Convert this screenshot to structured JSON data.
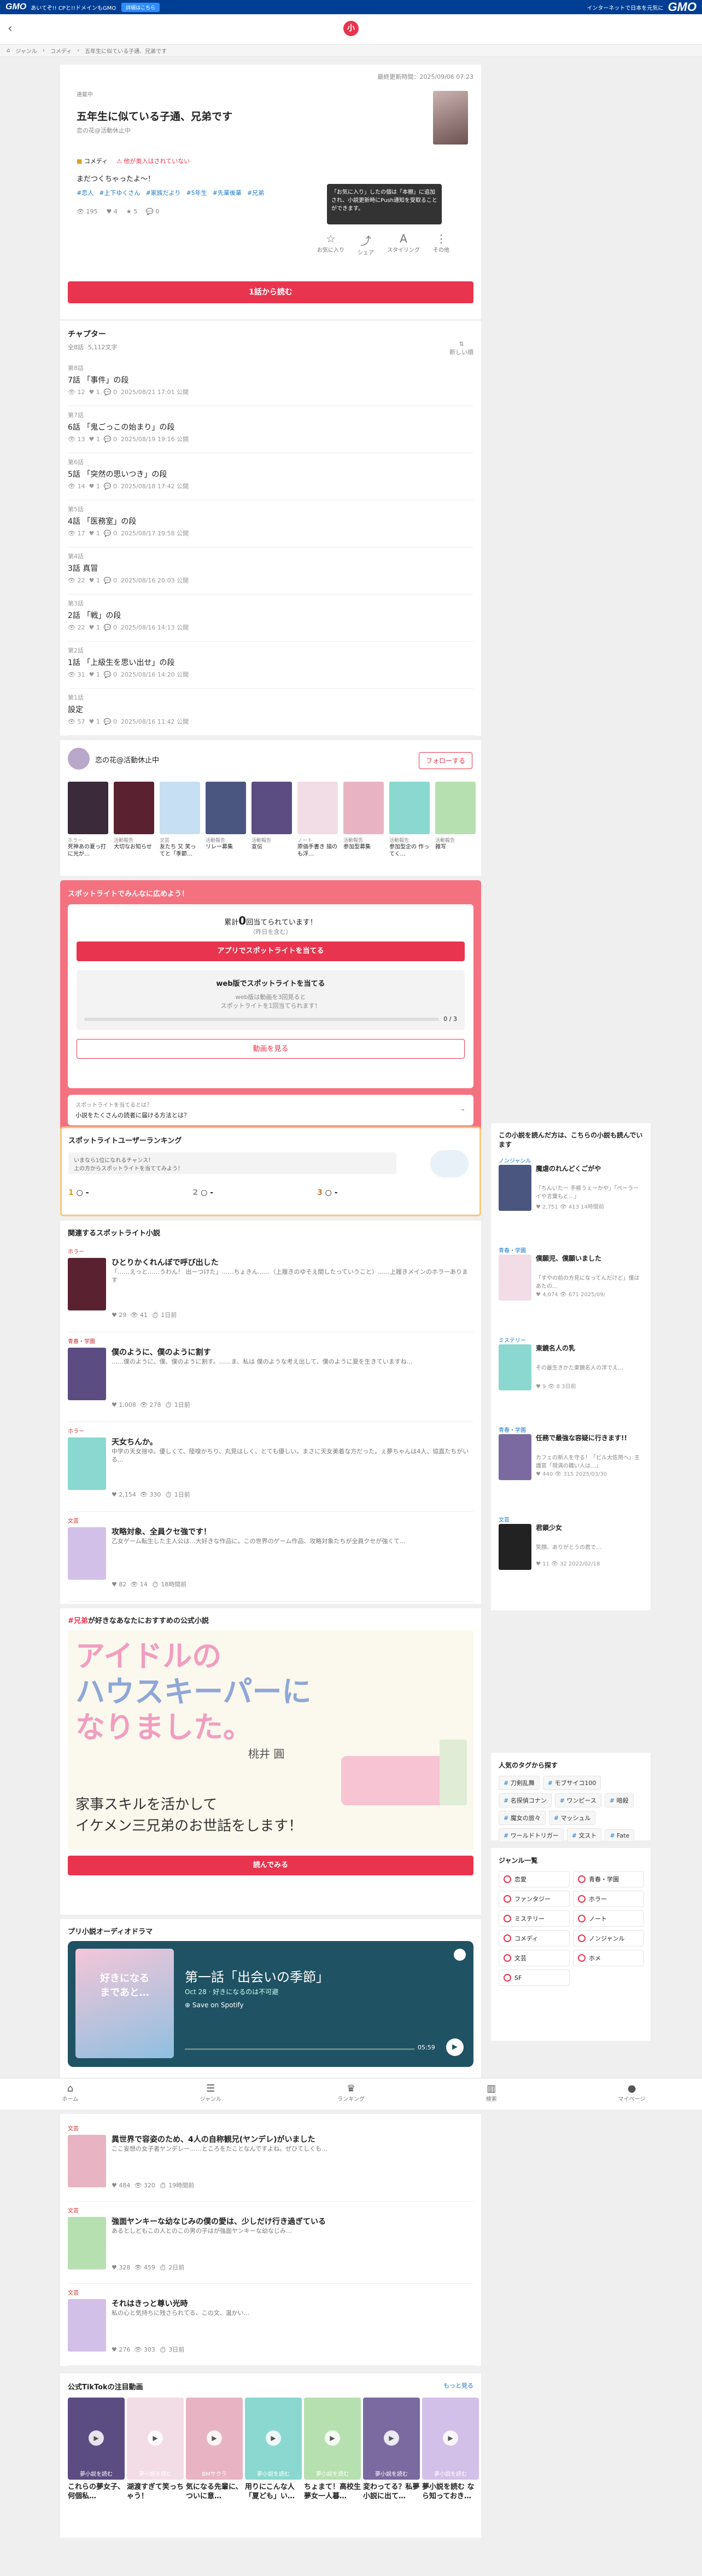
{
  "gmo": {
    "logo": "GMO",
    "tagline": "あいてぞ!! CPと!!ドメインもGMO",
    "pill": "詳細はこちら",
    "right_text": "インターネットで日本を元気に",
    "right_logo": "GMO"
  },
  "header": {
    "logo_char": "小"
  },
  "breadcrumb": [
    "ジャンル",
    "コメディ",
    "五年生に似ている子通、兄弟です"
  ],
  "novel": {
    "updated": "最終更新時間：2025/09/06 07:23",
    "status": "連載中",
    "title": "五年生に似ている子通、兄弟です",
    "author": "恋の花@活動休止中",
    "genre": "コメディ",
    "badge": "他が奥入はされていない",
    "desc": "まだつくちゃったよ〜！",
    "tags": [
      "#恋人",
      "#上下ゆくさん",
      "#家族だより",
      "#5年生",
      "#先輩後輩",
      "#兄弟"
    ],
    "stats": {
      "views": "195",
      "likes": "4",
      "stars": "5",
      "comments": "0"
    },
    "tooltip": "「お気に入り」したの個は「本棚」に追加され、小説更新時にPush通知を受取ることができます。",
    "actions": [
      "お気に入り",
      "シェア",
      "スタイリング",
      "その他"
    ],
    "read_btn": "1話から読む"
  },
  "chapters": {
    "title": "チャプター",
    "count": "全8話",
    "chars": "5,112文字",
    "sort": "新しい順",
    "items": [
      {
        "ep": "第8話",
        "title": "7話 「事件」の段",
        "views": "12",
        "likes": "1",
        "com": "0",
        "date": "2025/08/21 17:01 公開"
      },
      {
        "ep": "第7話",
        "title": "6話 「鬼ごっこの始まり」の段",
        "views": "13",
        "likes": "1",
        "com": "0",
        "date": "2025/08/19 19:16 公開"
      },
      {
        "ep": "第6話",
        "title": "5話 「突然の思いつき」の段",
        "views": "14",
        "likes": "1",
        "com": "0",
        "date": "2025/08/18 17:42 公開"
      },
      {
        "ep": "第5話",
        "title": "4話 「医務室」の段",
        "views": "17",
        "likes": "1",
        "com": "0",
        "date": "2025/08/17 19:58 公開"
      },
      {
        "ep": "第4話",
        "title": "3話 真冒",
        "views": "22",
        "likes": "1",
        "com": "0",
        "date": "2025/08/16 20:03 公開"
      },
      {
        "ep": "第3話",
        "title": "2話 「戦」の段",
        "views": "22",
        "likes": "1",
        "com": "0",
        "date": "2025/08/16 14:13 公開"
      },
      {
        "ep": "第2話",
        "title": "1話 「上級生を思い出せ」の段",
        "views": "31",
        "likes": "1",
        "com": "0",
        "date": "2025/08/16 14:20 公開"
      },
      {
        "ep": "第1話",
        "title": "設定",
        "views": "57",
        "likes": "1",
        "com": "0",
        "date": "2025/08/16 11:42 公開"
      }
    ]
  },
  "author_box": {
    "name": "恋の花@活動休止中",
    "follow": "フォローする",
    "works": [
      {
        "cat": "ホラー",
        "name": "死神あの夏っ打に光が…"
      },
      {
        "cat": "活動報告",
        "name": "大切なお知らせ"
      },
      {
        "cat": "文芸",
        "name": "友たち 又 笑ってと「季節…"
      },
      {
        "cat": "活動報告",
        "name": "リレー募集"
      },
      {
        "cat": "活動報告",
        "name": "宣伝"
      },
      {
        "cat": "ノート",
        "name": "原価手書き 描のも浮…"
      },
      {
        "cat": "活動報告",
        "name": "参加型募集"
      },
      {
        "cat": "活動報告",
        "name": "参加型企の 作ってく…"
      },
      {
        "cat": "活動報告",
        "name": "雑写"
      }
    ]
  },
  "spotlight": {
    "header": "スポットライトでみんなに広めよう！",
    "received_pre": "累計",
    "received_num": "0",
    "received_post": "回当てられています！",
    "received_sub": "（昨日を含む）",
    "btn": "アプリでスポットライトを当てる",
    "web_title": "web版でスポットライトを当てる",
    "web_desc": "web版は動画を3回見ると\nスポットライトを1回当てられます！",
    "progress_label": "0 / 3",
    "watch_btn": "動画を見る",
    "faq_q": "スポットライトを当てるとは？",
    "faq_a": "小説をたくさんの読者に届ける方法とは？"
  },
  "spot_ranking": {
    "title": "スポットライトユーザーランキング",
    "desc": "いまなら1位になれるチャンス！\n上の方からスポットライトを当ててみよう！",
    "ranks": [
      "1",
      "2",
      "3"
    ]
  },
  "related": {
    "title": "関連するスポットライト小説",
    "items": [
      {
        "genre": "ホラー",
        "title": "ひとりかくれんぼで呼び出した",
        "desc": "「……えっと……うわん！ 出ーつけた」……ちょきん……（上履きのゆそえ間したっていうこと）……上履きメインのホラーあります",
        "likes": "29",
        "views": "41",
        "date": "1日前"
      },
      {
        "genre": "青春・学園",
        "title": "僕のように、僕のように割す",
        "desc": "……僕のように、僕、僕のように割す。……ま、私は 僕のような考え出して、僕のように夏を生きていますね…",
        "likes": "1,008",
        "views": "278",
        "date": "1日前"
      },
      {
        "genre": "ホラー",
        "title": "天女ちんか。",
        "desc": "中学の天女捨ゆ。優しくて、陸嗅かちり、丸見はしく、とても優しい。まさに天女美着な方だった。ぇ夢ちゃんは4人、協直たちがいる…",
        "likes": "2,154",
        "views": "330",
        "date": "1日前"
      },
      {
        "genre": "文芸",
        "title": "攻略対象、全員クセ強です！",
        "desc": "乙女ゲーム転生した主人公は…大好きな作品に。この世界のゲーム作品、攻略対象たちが全員クセが強くて…",
        "likes": "82",
        "views": "14",
        "date": "18時間前"
      }
    ]
  },
  "official": {
    "tag": "#兄弟",
    "title_rest": "が好きなあなたにおすすめの公式小説",
    "banner_l1": "アイドルの",
    "banner_l2": "ハウスキーパーに",
    "banner_l3": "なりました。",
    "banner_author": "桃井 圓",
    "banner_sub1": "家事スキルを活かして",
    "banner_sub2": "イケメン三兄弟のお世話をします！",
    "btn": "読んでみる"
  },
  "audio": {
    "title": "プリ小説オーディオドラマ",
    "ep": "第一話「出会いの季節」",
    "meta": "Oct 28 · 好きになるのは不可避",
    "save": "Save on Spotify",
    "time": "05:59",
    "cover": "好きになる\nまであと…"
  },
  "sidebar": {
    "title": "この小説を読んだ方は、こちらの小説も読んでいます",
    "items": [
      {
        "genre": "ノンジャンル",
        "title": "魔虐のれんどくごがや",
        "desc": "「ちんいたー 手帳うぇーかや」「ペーラーイや言葉もと…」",
        "likes": "2,751",
        "views": "413",
        "date": "14時間前"
      },
      {
        "genre": "青春・学園",
        "title": "僕願児、僕願いました",
        "desc": "「すやの前の方見になってんだけど」僕はあたの…",
        "likes": "4,074",
        "views": "671",
        "date": "2025/09/"
      },
      {
        "genre": "ミステリー",
        "title": "東鏡名人の乳",
        "desc": "その最生きかた東鏡名人の洋でえ…",
        "likes": "9",
        "views": "8",
        "date": "3日前"
      },
      {
        "genre": "青春・学園",
        "title": "任務で最強な容疑に行きます!!",
        "desc": "カフェの新人を守る！「ビル大佐用へ」主護官「現満の職い人は…」",
        "likes": "440",
        "views": "315",
        "date": "2025/03/30"
      },
      {
        "genre": "文芸",
        "title": "君鎖少女",
        "desc": "笑顔、ありがとうの君で…",
        "likes": "11",
        "views": "32",
        "date": "2022/02/18"
      }
    ]
  },
  "popular_tags": {
    "title": "人気のタグから探す",
    "items": [
      "刀剣乱舞",
      "モブサイコ100",
      "名探偵コナン",
      "ワンピース",
      "暗殺",
      "魔女の旅々",
      "マッシュル",
      "ワールドトリガー",
      "文スト",
      "Fate"
    ]
  },
  "genres": {
    "title": "ジャンル一覧",
    "items": [
      "恋愛",
      "青春・学園",
      "ファンタジー",
      "ホラー",
      "ミステリー",
      "ノート",
      "コメディ",
      "ノンジャンル",
      "文芸",
      "ホメ",
      "SF"
    ]
  },
  "bottom_nav": [
    "ホーム",
    "ジャンル",
    "ランキング",
    "検索",
    "マイページ"
  ],
  "lower": {
    "items": [
      {
        "genre": "文芸",
        "title": "異世界で容姿のため、4人の自称観兄(ヤンデレ)がいました",
        "desc": "ここ妄想の女子者ヤンデレー……ところをたことなんですよね。ぜひてしくも…",
        "likes": "484",
        "views": "320",
        "date": "19時間前"
      },
      {
        "genre": "文芸",
        "title": "強面ヤンキーな幼なじみの僕の愛は、少しだけ行き過ぎている",
        "desc": "あるとしどもこの人とのこの男の子はが強面ヤンキーな幼なじみ…",
        "likes": "328",
        "views": "459",
        "date": "2日前"
      },
      {
        "genre": "文芸",
        "title": "それはきっと尊い光時",
        "desc": "私の心と気持ちに残さられてる、この文、温かい…",
        "likes": "276",
        "views": "303",
        "date": "3日前"
      }
    ]
  },
  "tiktok": {
    "title": "公式TikTokの注目動画",
    "more": "もっと見る",
    "items": [
      {
        "cap": "夢小説を読む",
        "t": "これらの夢女子、何個私…"
      },
      {
        "cap": "夢小説を読む",
        "t": "湖渡すぎて笑っちゃう！"
      },
      {
        "cap": "BMサクラ",
        "t": "気になる先輩に、ついに意…"
      },
      {
        "cap": "夢小説を読む",
        "t": "用りにこんな人「夏ども」い…"
      },
      {
        "cap": "夢小説を読む",
        "t": "ちょまて！高校生夢女一人暮…"
      },
      {
        "cap": "夢小説を読む",
        "t": "変わってる？私夢小説に出て…"
      },
      {
        "cap": "夢小説を読む",
        "t": "夢小説を読む なら知っておき…"
      }
    ]
  }
}
